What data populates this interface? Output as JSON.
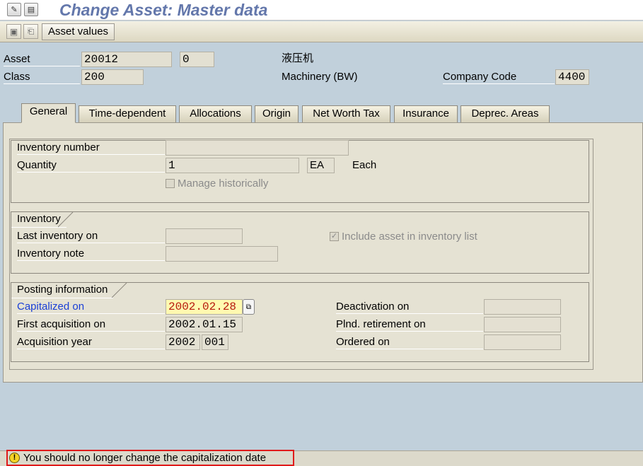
{
  "window": {
    "title": "Change Asset:  Master data"
  },
  "toolbar": {
    "asset_values_label": "Asset values"
  },
  "header": {
    "asset_label": "Asset",
    "asset_number": "20012",
    "asset_subnumber": "0",
    "asset_description": "液压机",
    "class_label": "Class",
    "class_value": "200",
    "class_description": "Machinery (BW)",
    "company_code_label": "Company Code",
    "company_code_value": "4400"
  },
  "tabs": [
    {
      "label": "General",
      "active": true
    },
    {
      "label": "Time-dependent",
      "active": false
    },
    {
      "label": "Allocations",
      "active": false
    },
    {
      "label": "Origin",
      "active": false
    },
    {
      "label": "Net Worth Tax",
      "active": false
    },
    {
      "label": "Insurance",
      "active": false
    },
    {
      "label": "Deprec. Areas",
      "active": false
    }
  ],
  "general": {
    "inventory_number_label": "Inventory number",
    "inventory_number_value": "",
    "quantity_label": "Quantity",
    "quantity_value": "1",
    "unit_value": "EA",
    "unit_text": "Each",
    "manage_historically_label": "Manage historically"
  },
  "inventory": {
    "title": "Inventory",
    "last_inventory_label": "Last inventory on",
    "last_inventory_value": "",
    "inventory_note_label": "Inventory note",
    "inventory_note_value": "",
    "include_in_list_label": "Include asset in inventory list",
    "include_in_list_checked": true
  },
  "posting": {
    "title": "Posting information",
    "capitalized_label": "Capitalized on",
    "capitalized_value": "2002.02.28",
    "first_acq_label": "First acquisition on",
    "first_acq_value": "2002.01.15",
    "acq_year_label": "Acquisition year",
    "acq_year_value": "2002",
    "acq_period_value": "001",
    "deactivation_label": "Deactivation on",
    "deactivation_value": "",
    "plnd_retirement_label": "Plnd. retirement on",
    "plnd_retirement_value": "",
    "ordered_label": "Ordered on",
    "ordered_value": ""
  },
  "status": {
    "message": "You should no longer change the capitalization date",
    "icon": "warning-icon"
  },
  "colors": {
    "title": "#6377ab",
    "background": "#c1d0db",
    "panel": "#e5e2d3",
    "focus_field": "#fff9b0",
    "highlight_border": "#e01b1b",
    "blue_label": "#1a3fd6"
  }
}
